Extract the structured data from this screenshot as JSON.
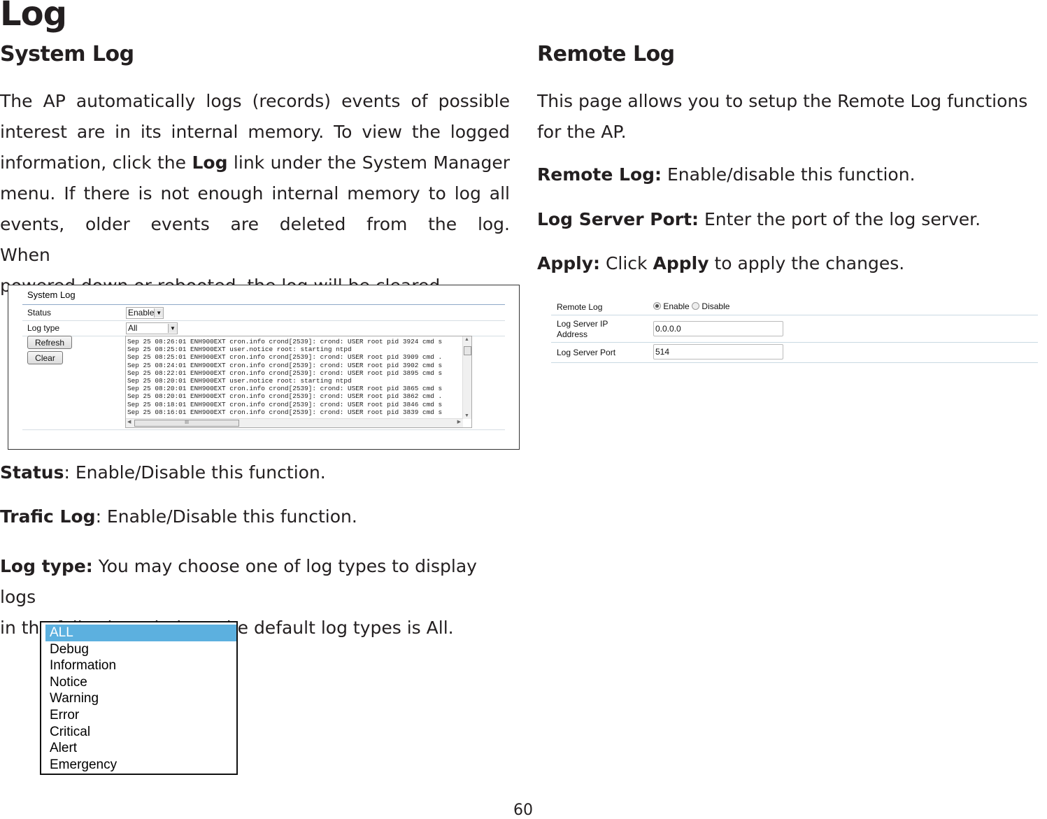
{
  "page": {
    "title": "Log",
    "page_number": "60"
  },
  "system_log": {
    "heading": "System Log",
    "intro_lines": [
      "The AP automatically logs (records) events of possible",
      "interest are in its internal memory. To view the logged",
      "information, click the ",
      "menu. If there is not enough internal memory to log all",
      "events, older events are deleted from the log. When",
      "powered down or rebooted, the log will be cleared."
    ],
    "intro_bold_link": "Log",
    "intro_line3_tail": " link under the System Manager",
    "panel": {
      "title": "System Log",
      "status_label": "Status",
      "status_value": "Enable",
      "log_type_label": "Log type",
      "log_type_value": "All",
      "refresh_label": "Refresh",
      "clear_label": "Clear",
      "scrollbar_grip": "III",
      "log_lines": [
        "Sep 25 08:26:01 ENH900EXT cron.info crond[2539]: crond: USER root pid 3924 cmd s",
        "Sep 25 08:25:01 ENH900EXT user.notice root: starting ntpd",
        "Sep 25 08:25:01 ENH900EXT cron.info crond[2539]: crond: USER root pid 3909 cmd .",
        "Sep 25 08:24:01 ENH900EXT cron.info crond[2539]: crond: USER root pid 3902 cmd s",
        "Sep 25 08:22:01 ENH900EXT cron.info crond[2539]: crond: USER root pid 3895 cmd s",
        "Sep 25 08:20:01 ENH900EXT user.notice root: starting ntpd",
        "Sep 25 08:20:01 ENH900EXT cron.info crond[2539]: crond: USER root pid 3865 cmd s",
        "Sep 25 08:20:01 ENH900EXT cron.info crond[2539]: crond: USER root pid 3862 cmd .",
        "Sep 25 08:18:01 ENH900EXT cron.info crond[2539]: crond: USER root pid 3846 cmd s",
        "Sep 25 08:16:01 ENH900EXT cron.info crond[2539]: crond: USER root pid 3839 cmd s"
      ]
    },
    "status_term": "Status",
    "status_desc": ": Enable/Disable this function.",
    "trafic_term": "Trafic Log",
    "trafic_desc": ": Enable/Disable this function.",
    "logtype_term": "Log type:",
    "logtype_desc_1": " You may choose one of log types to display logs",
    "logtype_desc_2": "in the following window. The default log types is All.",
    "log_type_options": [
      "ALL",
      "Debug",
      "Information",
      "Notice",
      "Warning",
      "Error",
      "Critical",
      "Alert",
      "Emergency"
    ],
    "log_type_selected": "ALL"
  },
  "remote_log": {
    "heading": "Remote Log",
    "intro_1": "This page allows you to setup the Remote Log functions",
    "intro_2": "for the AP.",
    "remote_term": "Remote Log:",
    "remote_desc": " Enable/disable this function.",
    "port_term": "Log Server Port:",
    "port_desc": " Enter the port of the log server.",
    "apply_term": "Apply:",
    "apply_desc_1": " Click ",
    "apply_bold": "Apply",
    "apply_desc_2": " to apply the changes.",
    "panel": {
      "remote_log_label": "Remote Log",
      "enable_label": "Enable",
      "disable_label": "Disable",
      "selected": "Enable",
      "ip_label_1": "Log Server IP",
      "ip_label_2": "Address",
      "ip_value": "0.0.0.0",
      "port_label": "Log Server Port",
      "port_value": "514"
    }
  }
}
